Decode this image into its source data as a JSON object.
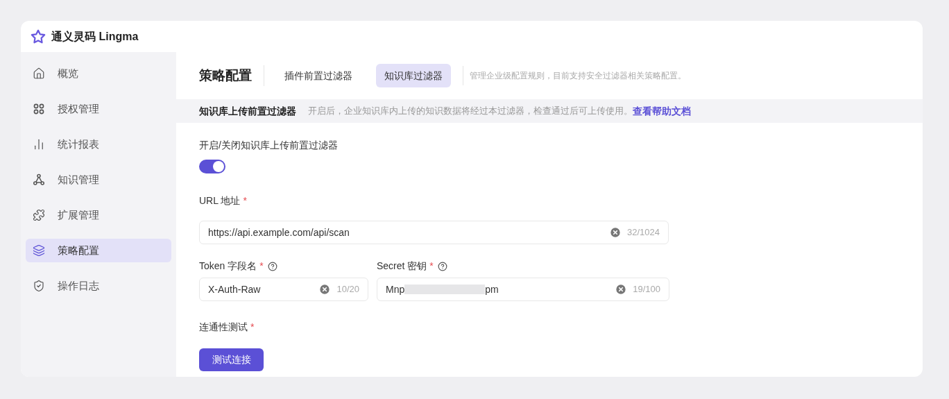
{
  "app": {
    "name": "通义灵码 Lingma"
  },
  "sidebar": {
    "items": [
      {
        "label": "概览",
        "selected": false
      },
      {
        "label": "授权管理",
        "selected": false
      },
      {
        "label": "统计报表",
        "selected": false
      },
      {
        "label": "知识管理",
        "selected": false
      },
      {
        "label": "扩展管理",
        "selected": false
      },
      {
        "label": "策略配置",
        "selected": true
      },
      {
        "label": "操作日志",
        "selected": false
      }
    ]
  },
  "page": {
    "title": "策略配置",
    "tabs": [
      {
        "label": "插件前置过滤器",
        "selected": false
      },
      {
        "label": "知识库过滤器",
        "selected": true
      }
    ],
    "description": "管理企业级配置规则，目前支持安全过滤器相关策略配置。"
  },
  "section": {
    "title": "知识库上传前置过滤器",
    "description": "开启后，企业知识库内上传的知识数据将经过本过滤器，检查通过后可上传使用。",
    "link": "查看帮助文档"
  },
  "form": {
    "toggle": {
      "label": "开启/关闭知识库上传前置过滤器",
      "on": true
    },
    "url": {
      "label": "URL 地址",
      "required_mark": "*",
      "value": "https://api.example.com/api/scan",
      "count": "32/1024"
    },
    "token": {
      "label": "Token 字段名",
      "required_mark": "*",
      "value": "X-Auth-Raw",
      "count": "10/20"
    },
    "secret": {
      "label": "Secret 密钥",
      "required_mark": "*",
      "value_start": "Mnp",
      "value_end": "pm",
      "count": "19/100"
    },
    "connectivity": {
      "label": "连通性测试",
      "required_mark": "*",
      "button": "测试连接"
    }
  }
}
